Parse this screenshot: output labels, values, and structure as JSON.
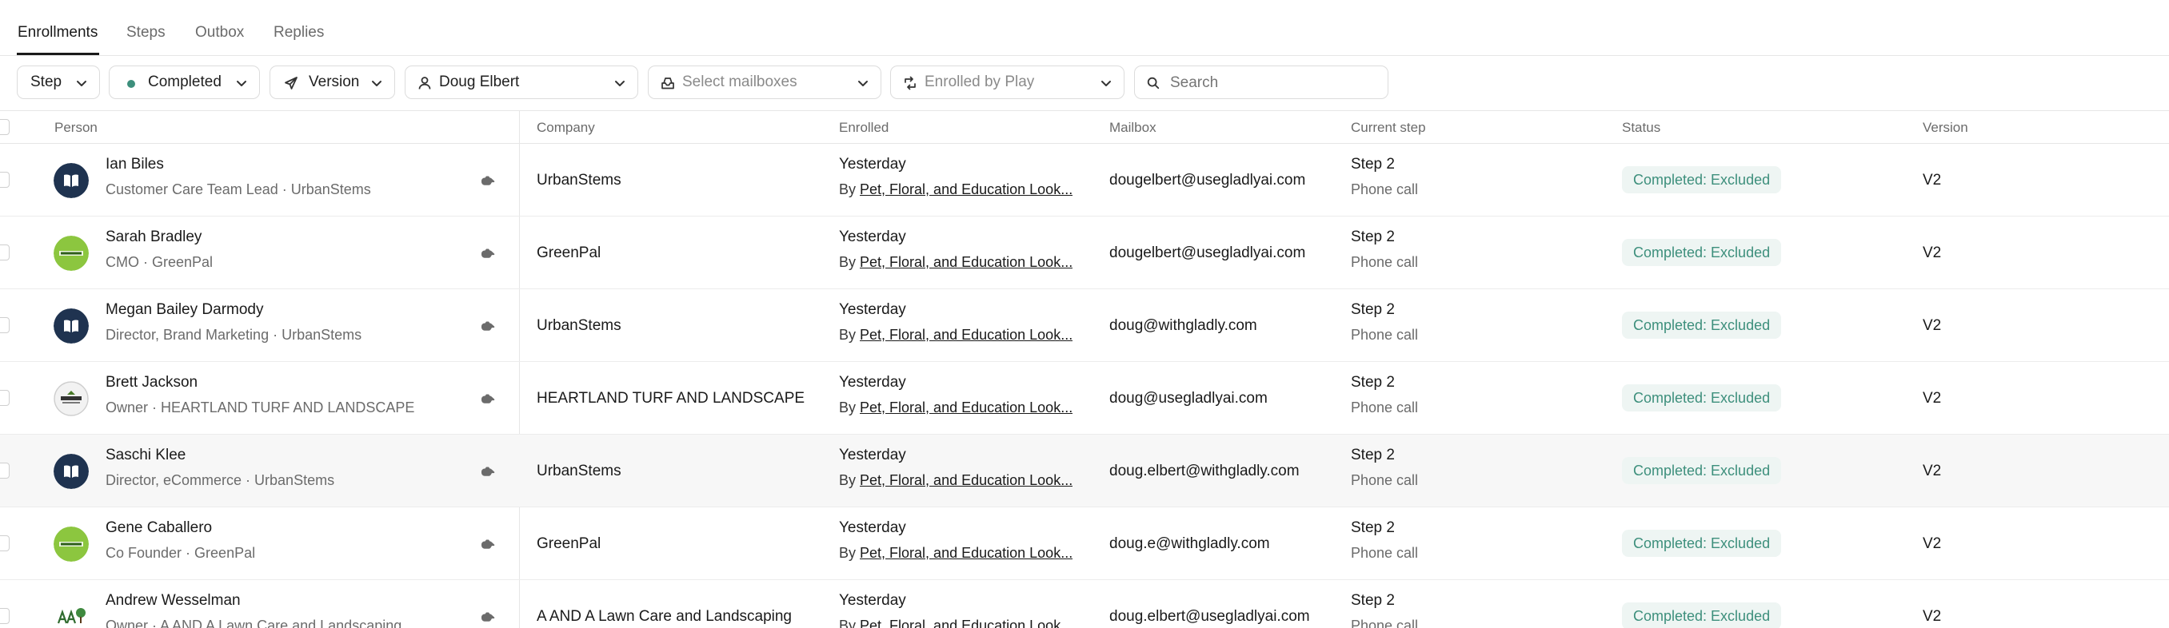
{
  "tabs": [
    {
      "label": "Enrollments",
      "active": true
    },
    {
      "label": "Steps",
      "active": false
    },
    {
      "label": "Outbox",
      "active": false
    },
    {
      "label": "Replies",
      "active": false
    }
  ],
  "filters": {
    "step": "Step",
    "status": "Completed",
    "status_color": "#3d8f7c",
    "version": "Version",
    "owner": "Doug Elbert",
    "mailboxes_placeholder": "Select mailboxes",
    "enrolled_by_placeholder": "Enrolled by Play",
    "search_placeholder": "Search"
  },
  "columns": {
    "person": "Person",
    "company": "Company",
    "enrolled": "Enrolled",
    "mailbox": "Mailbox",
    "current_step": "Current step",
    "status": "Status",
    "version": "Version"
  },
  "rows": [
    {
      "name": "Ian Biles",
      "subtitle": "Customer Care Team Lead · UrbanStems",
      "avatar": "urbanstems-logo",
      "company": "UrbanStems",
      "enrolled": "Yesterday",
      "enrolled_by_prefix": "By",
      "enrolled_by": "Pet, Floral, and Education Look...",
      "mailbox": "dougelbert@usegladlyai.com",
      "step": "Step 2",
      "step_type": "Phone call",
      "status": "Completed: Excluded",
      "version": "V2"
    },
    {
      "name": "Sarah Bradley",
      "subtitle": "CMO · GreenPal",
      "avatar": "greenpal-logo",
      "company": "GreenPal",
      "enrolled": "Yesterday",
      "enrolled_by_prefix": "By",
      "enrolled_by": "Pet, Floral, and Education Look...",
      "mailbox": "dougelbert@usegladlyai.com",
      "step": "Step 2",
      "step_type": "Phone call",
      "status": "Completed: Excluded",
      "version": "V2"
    },
    {
      "name": "Megan Bailey Darmody",
      "subtitle": "Director, Brand Marketing · UrbanStems",
      "avatar": "urbanstems-logo",
      "company": "UrbanStems",
      "enrolled": "Yesterday",
      "enrolled_by_prefix": "By",
      "enrolled_by": "Pet, Floral, and Education Look...",
      "mailbox": "doug@withgladly.com",
      "step": "Step 2",
      "step_type": "Phone call",
      "status": "Completed: Excluded",
      "version": "V2"
    },
    {
      "name": "Brett Jackson",
      "subtitle": "Owner · HEARTLAND TURF AND LANDSCAPE",
      "avatar": "heartland-logo",
      "company": "HEARTLAND TURF AND LANDSCAPE",
      "enrolled": "Yesterday",
      "enrolled_by_prefix": "By",
      "enrolled_by": "Pet, Floral, and Education Look...",
      "mailbox": "doug@usegladlyai.com",
      "step": "Step 2",
      "step_type": "Phone call",
      "status": "Completed: Excluded",
      "version": "V2"
    },
    {
      "name": "Saschi Klee",
      "subtitle": "Director, eCommerce · UrbanStems",
      "avatar": "urbanstems-logo",
      "company": "UrbanStems",
      "enrolled": "Yesterday",
      "enrolled_by_prefix": "By",
      "enrolled_by": "Pet, Floral, and Education Look...",
      "mailbox": "doug.elbert@withgladly.com",
      "step": "Step 2",
      "step_type": "Phone call",
      "status": "Completed: Excluded",
      "version": "V2"
    },
    {
      "name": "Gene Caballero",
      "subtitle": "Co Founder · GreenPal",
      "avatar": "greenpal-logo",
      "company": "GreenPal",
      "enrolled": "Yesterday",
      "enrolled_by_prefix": "By",
      "enrolled_by": "Pet, Floral, and Education Look...",
      "mailbox": "doug.e@withgladly.com",
      "step": "Step 2",
      "step_type": "Phone call",
      "status": "Completed: Excluded",
      "version": "V2"
    },
    {
      "name": "Andrew Wesselman",
      "subtitle": "Owner · A AND A Lawn Care and Landscaping",
      "avatar": "aa-lawn-logo",
      "company": "A AND A Lawn Care and Landscaping",
      "enrolled": "Yesterday",
      "enrolled_by_prefix": "By",
      "enrolled_by": "Pet, Floral, and Education Look...",
      "mailbox": "doug.elbert@usegladlyai.com",
      "step": "Step 2",
      "step_type": "Phone call",
      "status": "Completed: Excluded",
      "version": "V2"
    }
  ],
  "icons": {
    "status_dot": "status-dot-icon",
    "chevron": "chevron-down-icon",
    "play": "send-icon",
    "person": "person-icon",
    "mailbox": "inbox-icon",
    "enrolled_by": "route-icon",
    "search": "search-icon",
    "row_action": "hand-wave-icon"
  }
}
